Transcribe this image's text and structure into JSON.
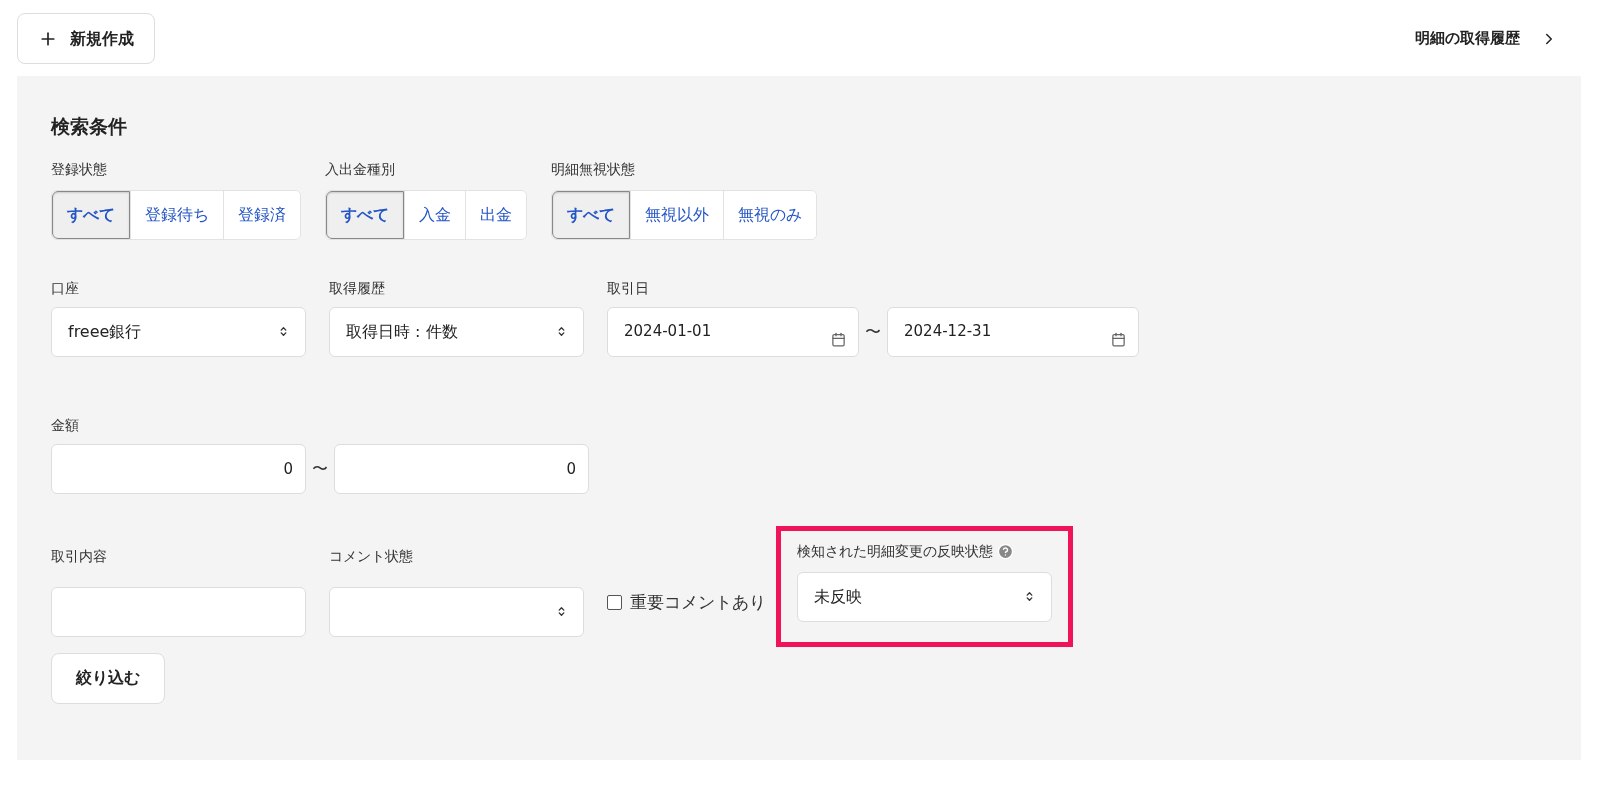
{
  "header": {
    "new_button": "新規作成",
    "history_link": "明細の取得履歴"
  },
  "search": {
    "title": "検索条件",
    "segments": [
      {
        "label": "登録状態",
        "options": [
          {
            "label": "すべて",
            "selected": true
          },
          {
            "label": "登録待ち",
            "selected": false
          },
          {
            "label": "登録済",
            "selected": false
          }
        ]
      },
      {
        "label": "入出金種別",
        "options": [
          {
            "label": "すべて",
            "selected": true
          },
          {
            "label": "入金",
            "selected": false
          },
          {
            "label": "出金",
            "selected": false
          }
        ]
      },
      {
        "label": "明細無視状態",
        "options": [
          {
            "label": "すべて",
            "selected": true
          },
          {
            "label": "無視以外",
            "selected": false
          },
          {
            "label": "無視のみ",
            "selected": false
          }
        ]
      }
    ],
    "account": {
      "label": "口座",
      "value": "freee銀行"
    },
    "fetch_history": {
      "label": "取得履歴",
      "value": "取得日時 : 件数"
    },
    "date": {
      "label": "取引日",
      "from": "2024-01-01",
      "separator": "〜",
      "to": "2024-12-31"
    },
    "amount": {
      "label": "金額",
      "from": "0",
      "separator": "〜",
      "to": "0"
    },
    "description": {
      "label": "取引内容"
    },
    "comment_status": {
      "label": "コメント状態"
    },
    "important_comment": {
      "label": "重要コメントあり",
      "checked": false
    },
    "reflection_status": {
      "label": "検知された明細変更の反映状態",
      "value": "未反映",
      "highlighted": true
    },
    "submit": "絞り込む"
  }
}
